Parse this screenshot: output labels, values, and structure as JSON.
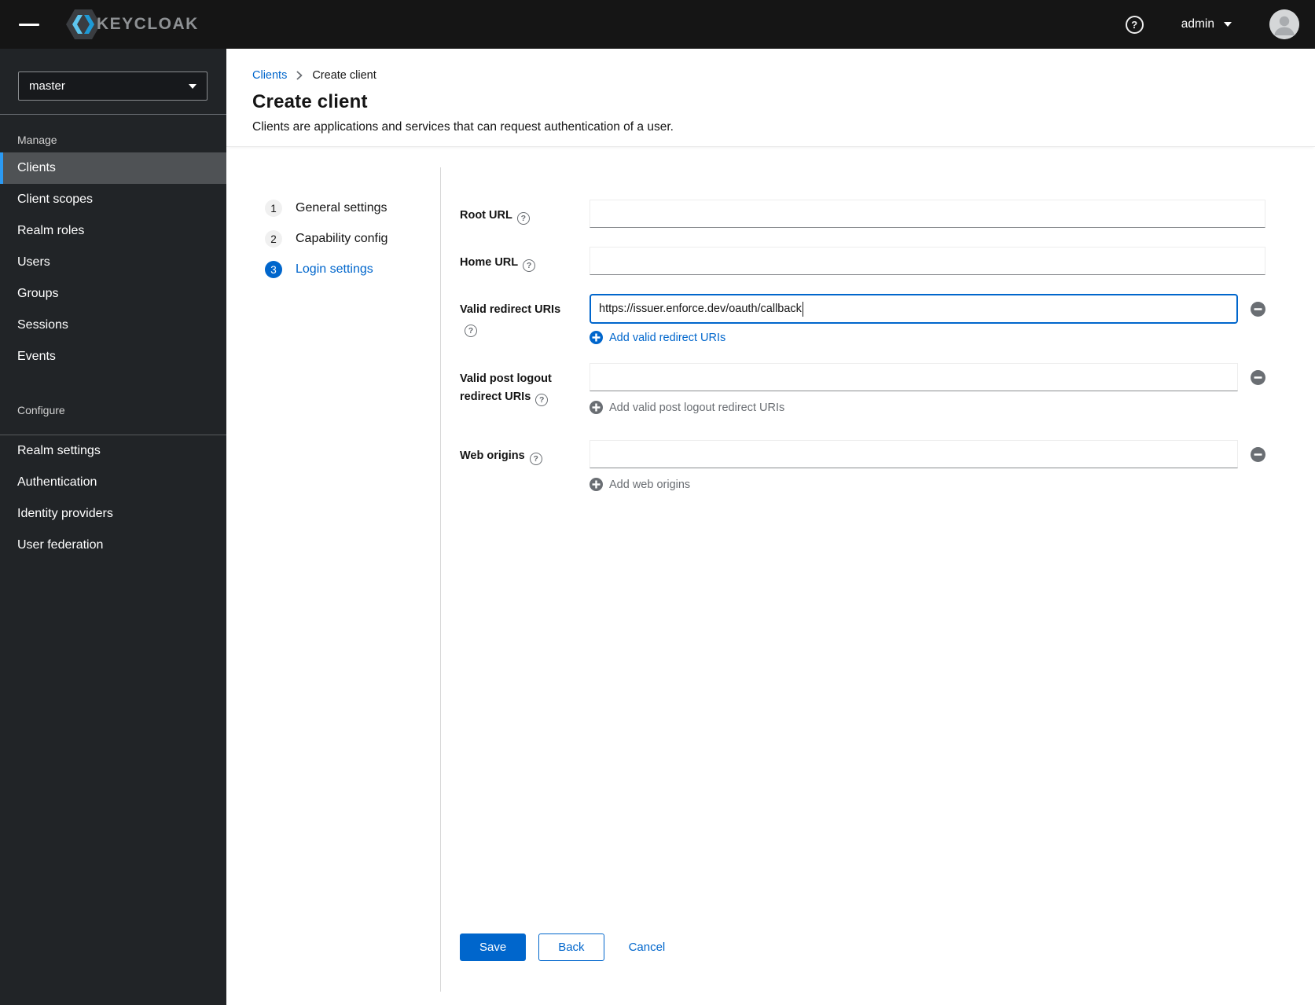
{
  "header": {
    "brand": "KEYCLOAK",
    "username": "admin",
    "icons": {
      "menu": "hamburger-menu-icon",
      "help": "question-circle-icon",
      "user_caret": "chevron-down-icon",
      "avatar": "user-avatar-icon"
    }
  },
  "sidebar": {
    "realm": "master",
    "realm_caret_icon": "chevron-down-icon",
    "sections": [
      {
        "title": "Manage",
        "items": [
          {
            "label": "Clients",
            "selected": true
          },
          {
            "label": "Client scopes",
            "selected": false
          },
          {
            "label": "Realm roles",
            "selected": false
          },
          {
            "label": "Users",
            "selected": false
          },
          {
            "label": "Groups",
            "selected": false
          },
          {
            "label": "Sessions",
            "selected": false
          },
          {
            "label": "Events",
            "selected": false
          }
        ]
      },
      {
        "title": "Configure",
        "items": [
          {
            "label": "Realm settings",
            "selected": false
          },
          {
            "label": "Authentication",
            "selected": false
          },
          {
            "label": "Identity providers",
            "selected": false
          },
          {
            "label": "User federation",
            "selected": false
          }
        ]
      }
    ]
  },
  "breadcrumb": {
    "items": [
      {
        "label": "Clients",
        "link": true
      },
      {
        "label": "Create client",
        "link": false
      }
    ],
    "separator_icon": "angle-right-icon"
  },
  "page": {
    "title": "Create client",
    "subtitle": "Clients are applications and services that can request authentication of a user."
  },
  "wizard": {
    "steps": [
      {
        "number": "1",
        "label": "General settings",
        "active": false
      },
      {
        "number": "2",
        "label": "Capability config",
        "active": false
      },
      {
        "number": "3",
        "label": "Login settings",
        "active": true
      }
    ]
  },
  "form": {
    "fields": [
      {
        "label": "Root URL",
        "value": "",
        "help_icon": "question-circle-icon"
      },
      {
        "label": "Home URL",
        "value": "",
        "help_icon": "question-circle-icon"
      },
      {
        "label": "Valid redirect URIs",
        "value": "https://issuer.enforce.dev/oauth/callback",
        "focused": true,
        "help_icon": "question-circle-icon",
        "remove_icon": "minus-circle-icon",
        "add_label": "Add valid redirect URIs",
        "add_enabled": true
      },
      {
        "label": "Valid post logout redirect URIs",
        "value": "",
        "help_icon": "question-circle-icon",
        "remove_icon": "minus-circle-icon",
        "add_label": "Add valid post logout redirect URIs",
        "add_enabled": false
      },
      {
        "label": "Web origins",
        "value": "",
        "help_icon": "question-circle-icon",
        "remove_icon": "minus-circle-icon",
        "add_label": "Add web origins",
        "add_enabled": false
      }
    ]
  },
  "actions": {
    "save": "Save",
    "back": "Back",
    "cancel": "Cancel"
  },
  "colors": {
    "primary_blue": "#0066cc",
    "header_bg": "#151515",
    "sidebar_bg": "#212427",
    "selected_item_bg": "#4f5255",
    "selected_item_border": "#2b9af3",
    "muted_gray": "#6a6e73",
    "input_bottom_border": "#8a8d90",
    "step_circle_bg": "#f0f0f0"
  }
}
